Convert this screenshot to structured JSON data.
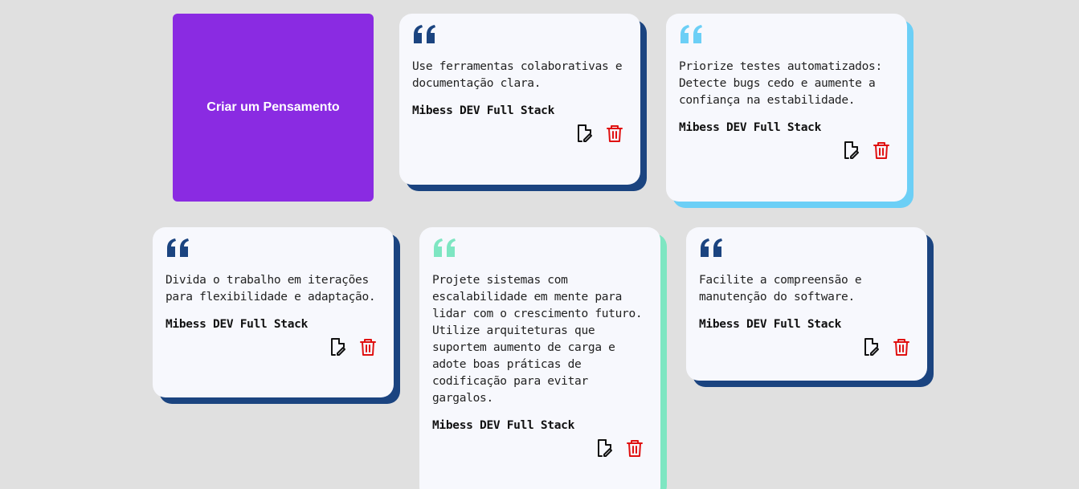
{
  "create_button": {
    "label": "Criar um Pensamento"
  },
  "colors": {
    "purple": "#8a2be2",
    "dark_blue": "#1b4480",
    "light_blue": "#6ccff6",
    "mint": "#7ee6c2",
    "delete_red": "#e01010",
    "card_bg": "#f7f8fd",
    "page_bg": "#e0e0e0"
  },
  "thoughts": [
    {
      "text": "Use ferramentas colaborativas e documentação clara.",
      "author": "Mibess DEV Full Stack",
      "accent": "#1b4480",
      "edit_icon": "edit-document-icon",
      "delete_icon": "trash-icon"
    },
    {
      "text": "Priorize testes automatizados: Detecte bugs cedo e aumente a confiança na estabilidade.",
      "author": "Mibess DEV Full Stack",
      "accent": "#6ccff6",
      "edit_icon": "edit-document-icon",
      "delete_icon": "trash-icon"
    },
    {
      "text": "Divida o trabalho em iterações para flexibilidade e adaptação.",
      "author": "Mibess DEV Full Stack",
      "accent": "#1b4480",
      "edit_icon": "edit-document-icon",
      "delete_icon": "trash-icon"
    },
    {
      "text": "Projete sistemas com escalabilidade em mente para lidar com o crescimento futuro. Utilize arquiteturas que suportem aumento de carga e adote boas práticas de codificação para evitar gargalos.",
      "author": "Mibess DEV Full Stack",
      "accent": "#7ee6c2",
      "edit_icon": "edit-document-icon",
      "delete_icon": "trash-icon"
    },
    {
      "text": "Facilite a compreensão e manutenção do software.",
      "author": "Mibess DEV Full Stack",
      "accent": "#1b4480",
      "edit_icon": "edit-document-icon",
      "delete_icon": "trash-icon"
    }
  ]
}
